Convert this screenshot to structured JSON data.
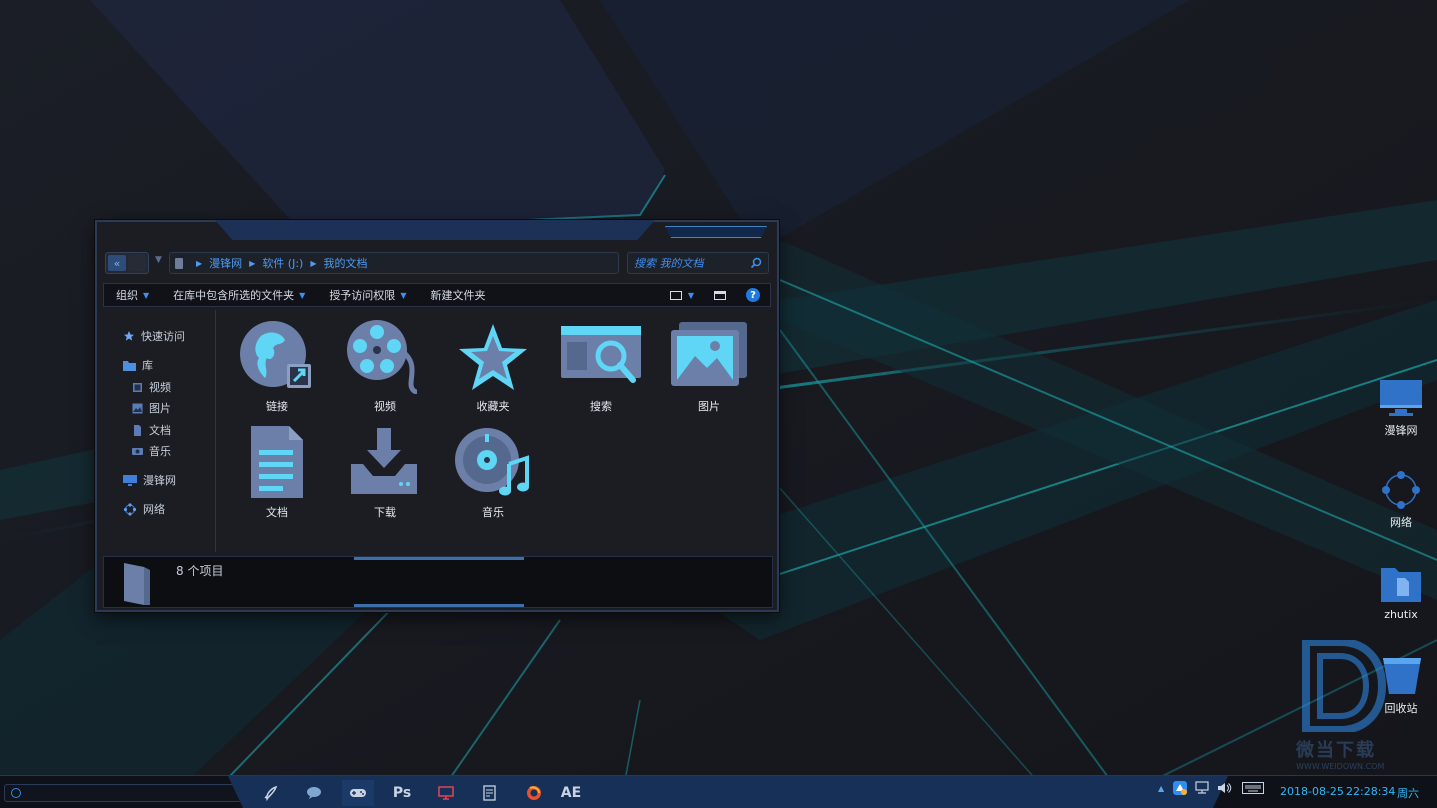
{
  "window": {
    "address": {
      "crumbs": [
        "漫锋网",
        "软件 (J:)",
        "我的文档"
      ]
    },
    "search": {
      "placeholder": "搜索 我的文档"
    },
    "commands": [
      {
        "label": "组织"
      },
      {
        "label": "在库中包含所选的文件夹"
      },
      {
        "label": "授予访问权限"
      },
      {
        "label": "新建文件夹"
      }
    ],
    "help_label": "?",
    "sidebar": {
      "quick_access": "快速访问",
      "library": "库",
      "library_items": [
        "视频",
        "图片",
        "文档",
        "音乐"
      ],
      "network_site": "漫锋网",
      "network": "网络"
    },
    "items": [
      {
        "label": "链接",
        "icon": "globe-shortcut-icon"
      },
      {
        "label": "视频",
        "icon": "film-reel-icon"
      },
      {
        "label": "收藏夹",
        "icon": "star-icon"
      },
      {
        "label": "搜索",
        "icon": "search-window-icon"
      },
      {
        "label": "图片",
        "icon": "pictures-icon"
      },
      {
        "label": "文档",
        "icon": "document-icon"
      },
      {
        "label": "下载",
        "icon": "download-icon"
      },
      {
        "label": "音乐",
        "icon": "music-disc-icon"
      }
    ],
    "status": {
      "count_text": "8 个项目"
    }
  },
  "desktop": {
    "icons": [
      {
        "label": "漫锋网",
        "icon": "monitor-icon"
      },
      {
        "label": "网络",
        "icon": "network-icon"
      },
      {
        "label": "zhutix",
        "icon": "folder-icon"
      },
      {
        "label": "回收站",
        "icon": "recycle-bin-icon"
      }
    ],
    "watermark": {
      "text": "微当下载",
      "url": "WWW.WEIDOWN.COM"
    }
  },
  "taskbar": {
    "apps": [
      {
        "label": "",
        "icon": "rocket-icon"
      },
      {
        "label": "",
        "icon": "chat-bubble-icon"
      },
      {
        "label": "",
        "icon": "gamepad-icon"
      },
      {
        "label": "Ps",
        "icon": "photoshop-icon"
      },
      {
        "label": "",
        "icon": "monitor-icon"
      },
      {
        "label": "",
        "icon": "notepad-icon"
      },
      {
        "label": "",
        "icon": "firefox-icon"
      },
      {
        "label": "AE",
        "icon": "after-effects-icon"
      }
    ],
    "clock": {
      "date": "2018-08-25",
      "time": "22:28:34",
      "weekday": "周六"
    }
  },
  "colors": {
    "accent": "#2f8ff0",
    "icon_fill": "#6b7fa8",
    "icon_highlight": "#5fd6f5"
  }
}
